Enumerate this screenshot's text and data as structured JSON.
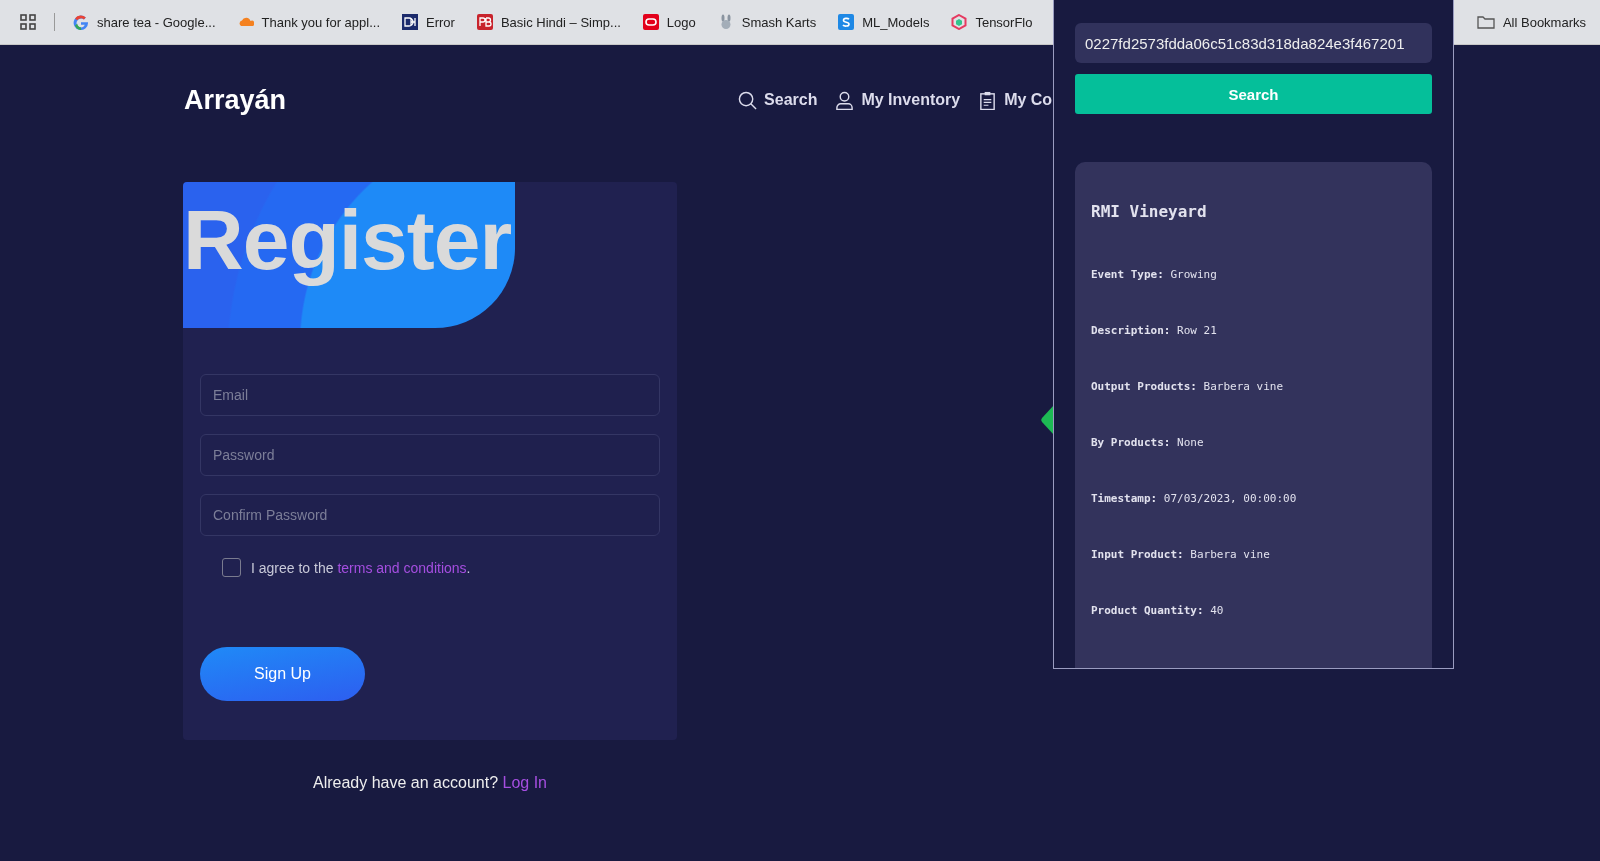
{
  "bookmarks_bar": {
    "items": [
      {
        "label": "share tea - Google...",
        "kind": "google"
      },
      {
        "label": "Thank you for appl...",
        "kind": "cloud"
      },
      {
        "label": "Error",
        "kind": "dh"
      },
      {
        "label": "Basic Hindi – Simp...",
        "kind": "pb"
      },
      {
        "label": "Logo",
        "kind": "oval"
      },
      {
        "label": "Smash Karts",
        "kind": "bunny"
      },
      {
        "label": "ML_Models",
        "kind": "s"
      },
      {
        "label": "TensorFlo",
        "kind": "tf"
      }
    ],
    "all_bookmarks": "All Bookmarks"
  },
  "header": {
    "logo": "Arrayán",
    "nav": [
      {
        "label": "Search",
        "kind": "search"
      },
      {
        "label": "My Inventory",
        "kind": "person"
      },
      {
        "label": "My Co",
        "kind": "clipboard"
      }
    ]
  },
  "register": {
    "title": "Register",
    "fields": [
      {
        "placeholder": "Email"
      },
      {
        "placeholder": "Password"
      },
      {
        "placeholder": "Confirm Password"
      }
    ],
    "agree": {
      "checked": false,
      "text": "I agree to the ",
      "link": "terms and conditions",
      "after": "."
    },
    "submit": "Sign Up"
  },
  "login_prompt": {
    "text": "Already have an account?",
    "link": "Log In"
  },
  "popup": {
    "search_value": "0227fd2573fdda06c51c83d318da824e3f467201",
    "search_button": "Search",
    "result": {
      "title": "RMI Vineyard",
      "details": [
        {
          "label": "Event Type:",
          "value": "Growing"
        },
        {
          "label": "Description:",
          "value": "Row 21"
        },
        {
          "label": "Output Products:",
          "value": "Barbera vine"
        },
        {
          "label": "By Products:",
          "value": "None"
        },
        {
          "label": "Timestamp:",
          "value": "07/03/2023, 00:00:00"
        },
        {
          "label": "Input Product:",
          "value": "Barbera vine"
        },
        {
          "label": "Product Quantity:",
          "value": "40"
        }
      ]
    }
  }
}
